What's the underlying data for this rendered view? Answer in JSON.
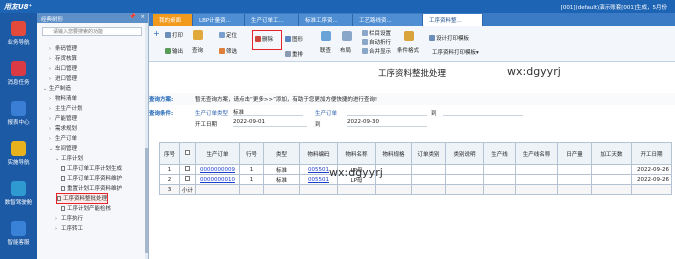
{
  "app": {
    "logo": "用友U8⁺",
    "info": "[001](default)演示账套[001]生成，5月份"
  },
  "nav": [
    {
      "label": "业务导航",
      "color": "#e34a3c"
    },
    {
      "label": "消息任务",
      "color": "#d93a43"
    },
    {
      "label": "报表中心",
      "color": "#3a7fd5"
    },
    {
      "label": "实施导航",
      "color": "#e8b21d"
    },
    {
      "label": "数智驾驶舱",
      "color": "#2e9ad0"
    },
    {
      "label": "智能客服",
      "color": "#3a82d8"
    }
  ],
  "tree": {
    "title": "经典树形",
    "pin": "📌",
    "close": "×",
    "search_placeholder": "请输入您要搜索的功能",
    "items": [
      {
        "arrow": "›",
        "label": "条码管理"
      },
      {
        "arrow": "›",
        "label": "存货核算"
      },
      {
        "arrow": "›",
        "label": "出口管理"
      },
      {
        "arrow": "›",
        "label": "进口管理"
      },
      {
        "arrow": "⌄",
        "label": "生产制造"
      },
      {
        "arrow": "›",
        "label": "物料清单"
      },
      {
        "arrow": "›",
        "label": "主生产计划"
      },
      {
        "arrow": "›",
        "label": "产能管理"
      },
      {
        "arrow": "›",
        "label": "需求规划"
      },
      {
        "arrow": "›",
        "label": "生产订单"
      },
      {
        "arrow": "⌄",
        "label": "车间管理"
      },
      {
        "arrow": "⌄",
        "label": "工序计划"
      },
      {
        "arrow": "",
        "label": "工序订单工序计划生成"
      },
      {
        "arrow": "",
        "label": "工序订单工序资料维护"
      },
      {
        "arrow": "",
        "label": "重置计划工序资料维护"
      },
      {
        "arrow": "",
        "label": "工序资料整批处理"
      },
      {
        "arrow": "",
        "label": "工序计划产能检核"
      },
      {
        "arrow": "›",
        "label": "工序执行"
      },
      {
        "arrow": "›",
        "label": "工序转工"
      }
    ]
  },
  "tabs": [
    "我的桌面",
    "LBP计量资...",
    "生产订单工...",
    "标准工序资...",
    "工艺路线资...",
    "工序资料整..."
  ],
  "toolbar": {
    "add": "+",
    "print": "打印",
    "output": "输出",
    "query": "查询",
    "locate": "定位",
    "filter": "筛选",
    "delete": "删除",
    "chart": "图形",
    "reorder": "重排",
    "bind": "联查",
    "layout": "布局",
    "column_set": "栏目设置",
    "auto_fold": "自动折行",
    "merge_show": "合并显示",
    "cond_format": "条件格式",
    "design_print": "设计打印模板",
    "print_template": "工序资料打印模板▾"
  },
  "content": {
    "title": "工序资料整批处理",
    "watermark": "wx:dgyyrj",
    "scheme_label": "查询方案:",
    "scheme_hint": "暂无查询方案，请点击“更多>>”添加，有助于您更加方便快捷的进行查询!",
    "cond_label": "查询条件:",
    "order_type_label": "生产订单类型",
    "order_type_value": "标准",
    "order_label": "生产订单",
    "to1": "到",
    "date_label": "开工日期",
    "date_from": "2022-09-01",
    "to2": "到",
    "date_to": "2022-09-30"
  },
  "grid": {
    "headers": [
      "序号",
      "",
      "生产订单",
      "行号",
      "类型",
      "物料编码",
      "物料名称",
      "物料规格",
      "订单类别",
      "类别说明",
      "生产线",
      "生产线名称",
      "日产量",
      "加工天数",
      "开工日期"
    ],
    "rows": [
      [
        "1",
        "",
        "0000000009",
        "1",
        "标准",
        "005501",
        "LP母",
        "",
        "",
        "",
        "",
        "",
        "",
        "",
        "2022-09-26"
      ],
      [
        "2",
        "",
        "0000000010",
        "1",
        "标准",
        "005501",
        "LP母",
        "",
        "",
        "",
        "",
        "",
        "",
        "",
        "2022-09-26"
      ],
      [
        "3",
        "小计",
        "",
        "",
        "",
        "",
        "",
        "",
        "",
        "",
        "",
        "",
        "",
        "",
        ""
      ]
    ]
  }
}
